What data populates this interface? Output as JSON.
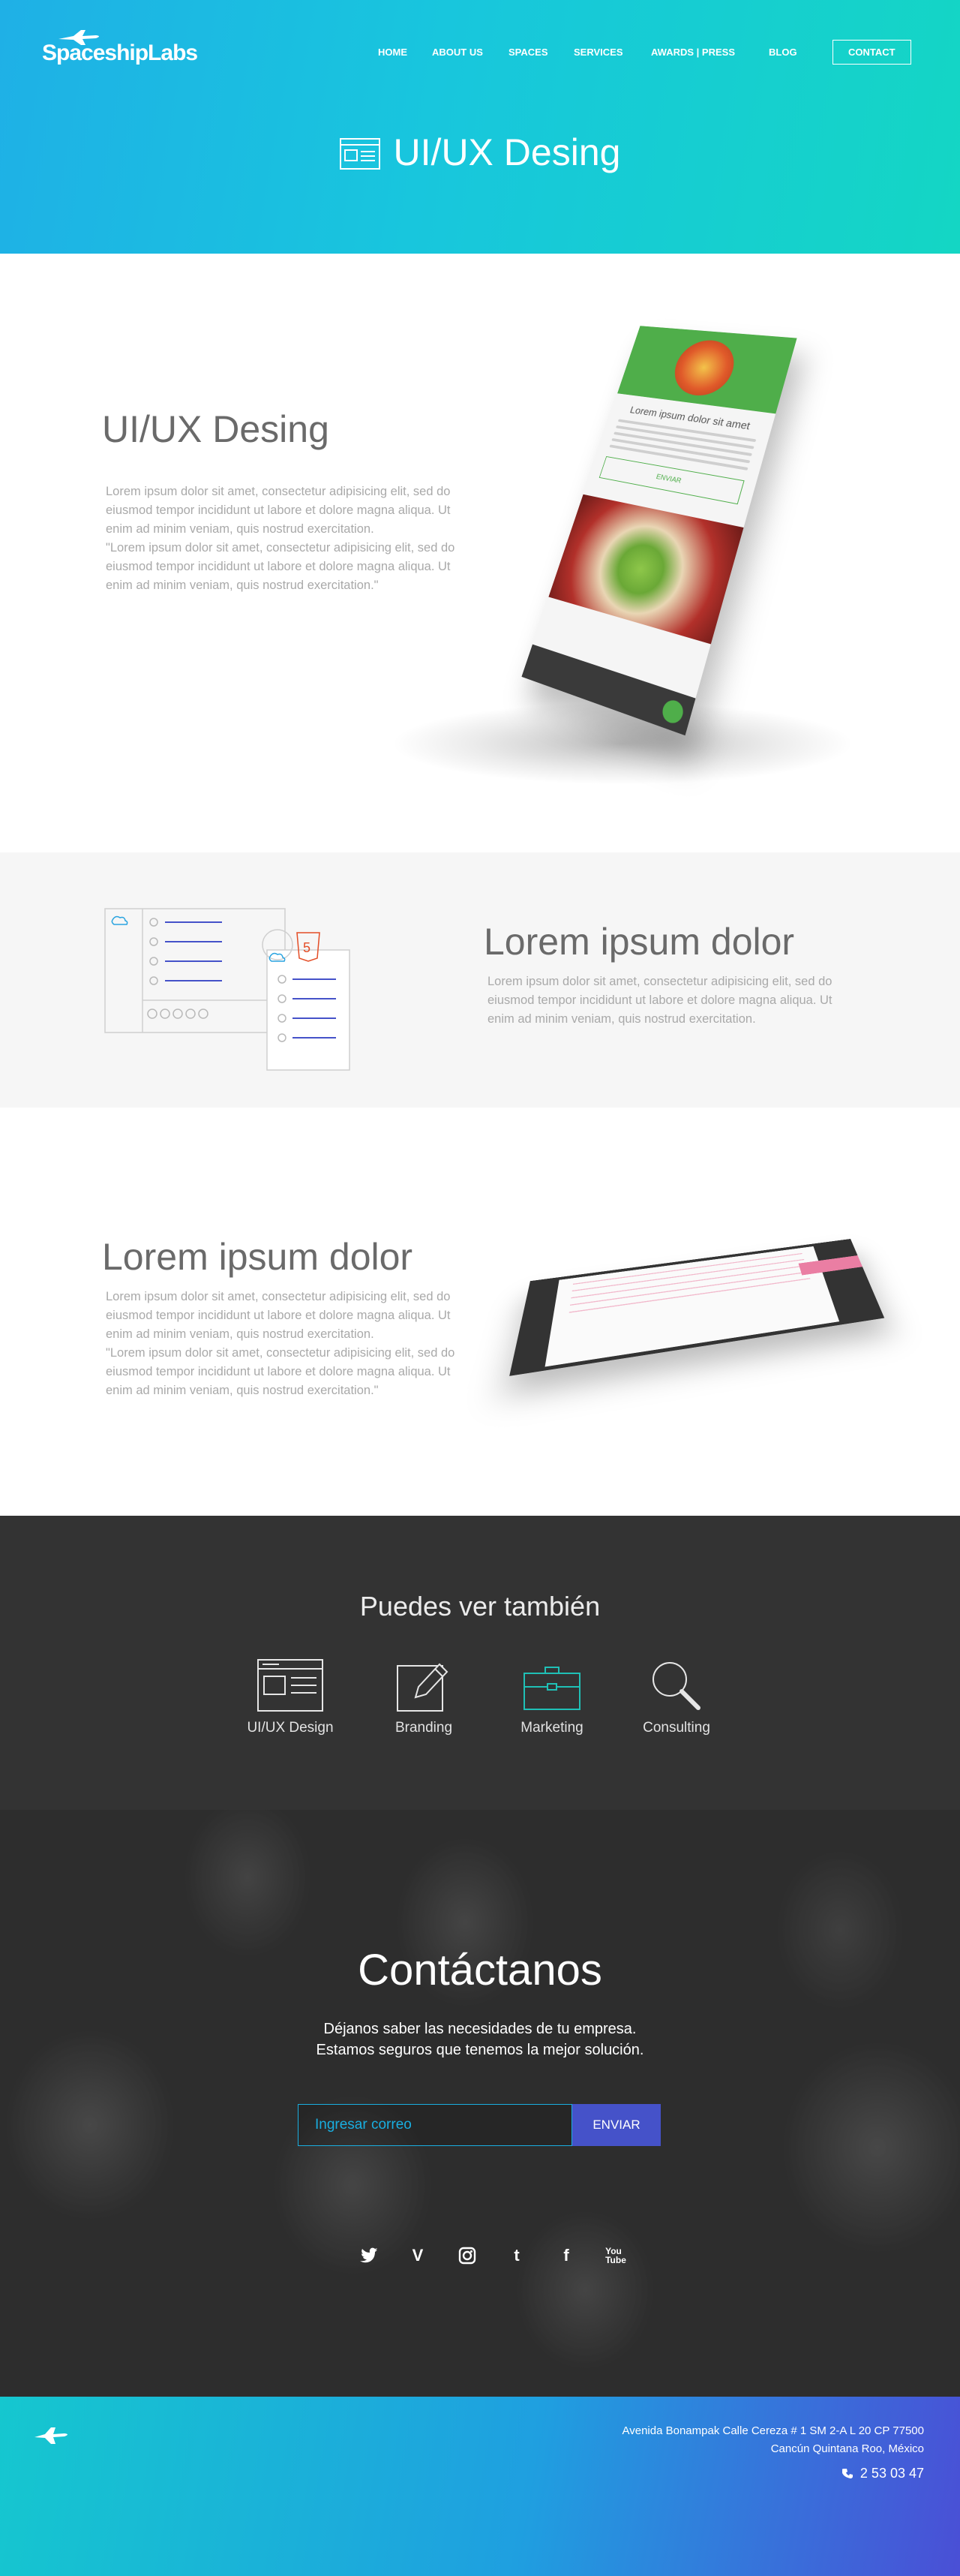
{
  "brand": {
    "name": "SpaceshipLabs"
  },
  "nav": {
    "items": [
      "HOME",
      "ABOUT US",
      "SPACES",
      "SERVICES",
      "AWARDS | PRESS",
      "BLOG"
    ],
    "contact_label": "CONTACT"
  },
  "hero": {
    "title": "UI/UX Desing"
  },
  "section1": {
    "title": "UI/UX Desing",
    "lines": [
      "Lorem ipsum dolor sit amet, consectetur adipisicing elit, sed do",
      "eiusmod tempor incididunt ut labore et dolore magna aliqua. Ut",
      "enim ad minim veniam, quis nostrud exercitation.",
      "\"Lorem ipsum dolor sit amet, consectetur adipisicing elit, sed do",
      "eiusmod tempor incididunt ut labore et dolore magna aliqua. Ut",
      "enim ad minim veniam, quis nostrud exercitation.\""
    ],
    "phone_heading": "Lorem ipsum dolor sit amet",
    "phone_button": "ENVIAR"
  },
  "section2": {
    "title": "Lorem ipsum dolor",
    "lines": [
      "Lorem ipsum dolor sit amet, consectetur adipisicing elit, sed do",
      "eiusmod tempor incididunt ut labore et dolore magna aliqua. Ut",
      "enim ad minim veniam, quis nostrud exercitation."
    ]
  },
  "section3": {
    "title": "Lorem ipsum dolor",
    "lines": [
      "Lorem ipsum dolor sit amet, consectetur adipisicing elit, sed do",
      "eiusmod tempor incididunt ut labore et dolore magna aliqua. Ut",
      "enim ad minim veniam, quis nostrud exercitation.",
      "\"Lorem ipsum dolor sit amet, consectetur adipisicing elit, sed do",
      "eiusmod tempor incididunt ut labore et dolore magna aliqua. Ut",
      "enim ad minim veniam, quis nostrud exercitation.\""
    ]
  },
  "also": {
    "title": "Puedes ver también",
    "services": [
      {
        "label": "UI/UX Design",
        "icon": "layout-icon"
      },
      {
        "label": "Branding",
        "icon": "pen-icon"
      },
      {
        "label": "Marketing",
        "icon": "briefcase-icon"
      },
      {
        "label": "Consulting",
        "icon": "magnifier-icon"
      }
    ]
  },
  "contact": {
    "title": "Contáctanos",
    "sub_1": "Déjanos saber las necesidades de tu empresa.",
    "sub_2": "Estamos seguros que tenemos la mejor solución.",
    "email_placeholder": "Ingresar correo",
    "submit_label": "ENVIAR",
    "social": [
      "twitter-icon",
      "vimeo-icon",
      "instagram-icon",
      "tumblr-icon",
      "facebook-icon",
      "youtube-icon"
    ]
  },
  "footer": {
    "address_1": "Avenida Bonampak Calle Cereza # 1 SM 2-A L 20 CP 77500",
    "address_2": "Cancún Quintana Roo, México",
    "phone": "2 53 03 47"
  },
  "colors": {
    "accent_cyan": "#19aee0",
    "accent_teal": "#14d6c4",
    "accent_indigo": "#4552c9",
    "dark_band": "#333333",
    "app_green": "#4fae4a",
    "app_pink": "#ea7ea3"
  }
}
